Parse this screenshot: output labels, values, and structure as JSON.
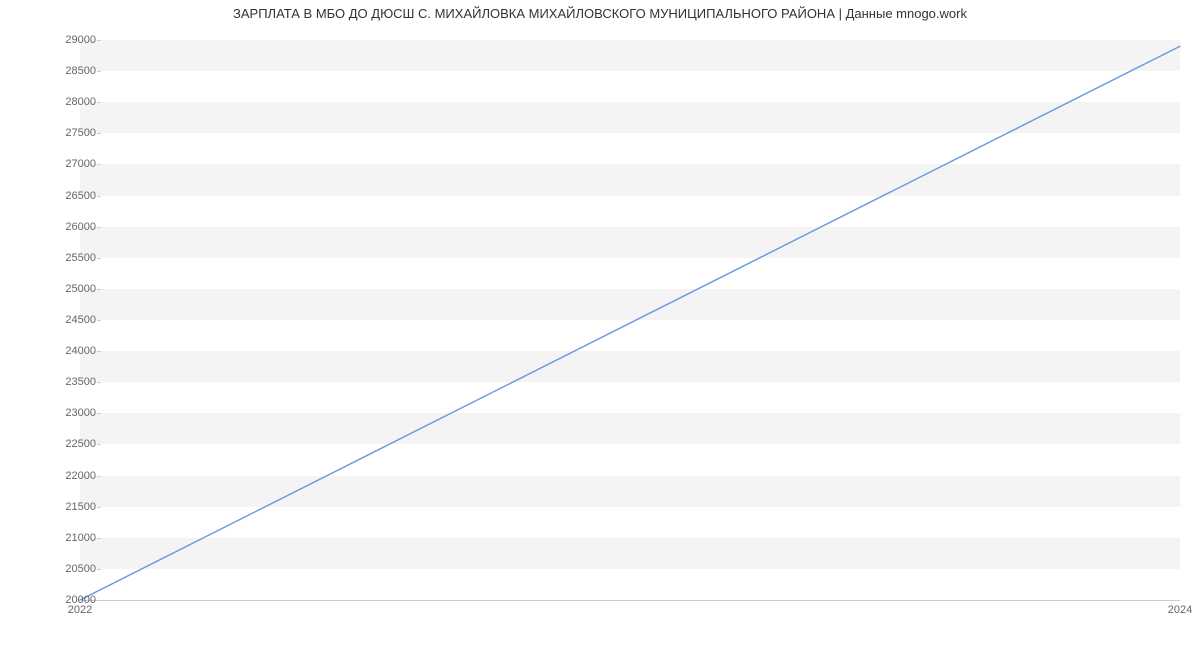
{
  "chart_data": {
    "type": "line",
    "title": "ЗАРПЛАТА В МБО ДО ДЮСШ С. МИХАЙЛОВКА МИХАЙЛОВСКОГО МУНИЦИПАЛЬНОГО РАЙОНА | Данные mnogo.work",
    "xlabel": "",
    "ylabel": "",
    "x": [
      2022,
      2024
    ],
    "values": [
      20000,
      28900
    ],
    "x_ticks": [
      2022,
      2024
    ],
    "y_ticks": [
      20000,
      20500,
      21000,
      21500,
      22000,
      22500,
      23000,
      23500,
      24000,
      24500,
      25000,
      25500,
      26000,
      26500,
      27000,
      27500,
      28000,
      28500,
      29000
    ],
    "xlim": [
      2022,
      2024
    ],
    "ylim": [
      20000,
      29000
    ],
    "line_color": "#6699de"
  }
}
